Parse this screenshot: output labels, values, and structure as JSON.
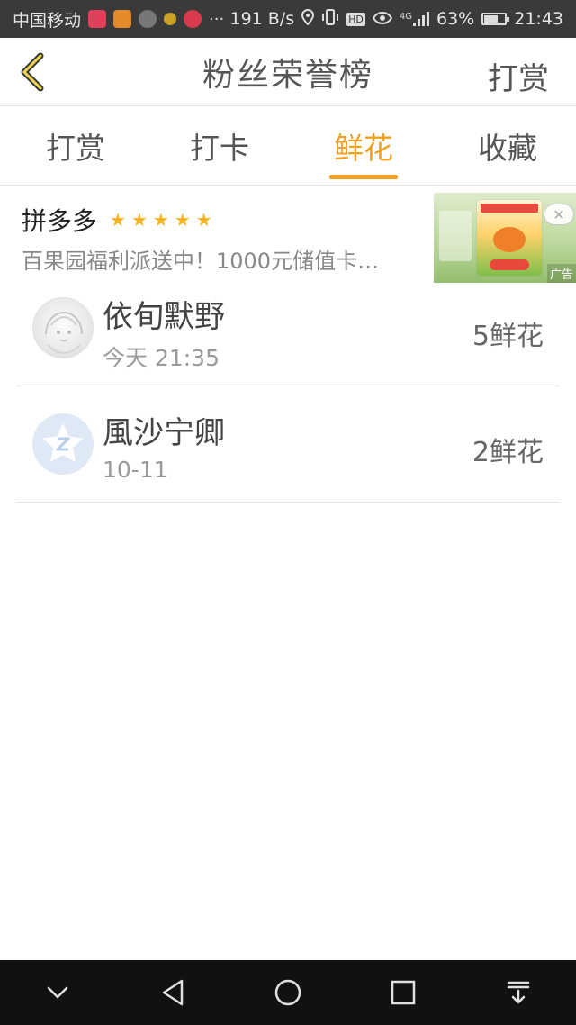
{
  "status_bar": {
    "carrier": "中国移动",
    "more": "···",
    "speed": "191 B/s",
    "hd": "HD",
    "network": "4G",
    "battery": "63%",
    "battery_level": 0.63,
    "time": "21:43"
  },
  "header": {
    "back_icon": "chevron-left-icon",
    "title": "粉丝荣誉榜",
    "action_label": "打赏",
    "accent_color": "#f0a020"
  },
  "tabs": [
    {
      "label": "打赏",
      "active": false
    },
    {
      "label": "打卡",
      "active": false
    },
    {
      "label": "鲜花",
      "active": true
    },
    {
      "label": "收藏",
      "active": false
    }
  ],
  "ad": {
    "title": "拼多多",
    "rating_stars": 5,
    "description": "百果园福利派送中！1000元储值卡…",
    "close_icon": "close-icon",
    "label": "广告"
  },
  "list": [
    {
      "name": "依旬默野",
      "time": "今天 21:35",
      "amount": "5鲜花",
      "avatar": "sketch-avatar"
    },
    {
      "name": "風沙宁卿",
      "time": "10-11",
      "amount": "2鲜花",
      "avatar": "qq-default-avatar"
    }
  ],
  "navbar": {
    "items": [
      "collapse-icon",
      "back-triangle-icon",
      "home-circle-icon",
      "recents-square-icon",
      "notification-pull-icon"
    ]
  }
}
